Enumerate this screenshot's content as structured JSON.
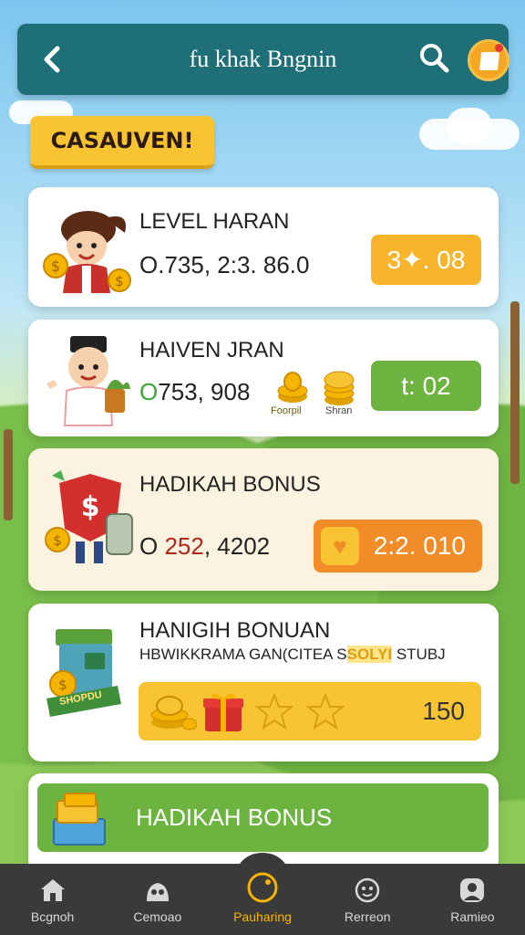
{
  "header": {
    "title": "fu khak Bngnin",
    "back_icon": "back-arrow-icon",
    "search_icon": "search-icon",
    "profile_icon": "notification-avatar-icon"
  },
  "tag": {
    "label": "CASAUVEN!"
  },
  "cards": [
    {
      "title": "LEVEL HARAN",
      "value": "O.735, 2:3. 86.0",
      "badge": "3✦. 08",
      "badge_color": "#f8b52c"
    },
    {
      "title": "HAIVEN JRAN",
      "value_prefix": "O",
      "value": "753, 908",
      "coin_label_1": "Foorpil",
      "coin_label_2": "Shran",
      "badge": "t: 02",
      "badge_color": "#6cb33f"
    },
    {
      "title": "HADIKAH BONUS",
      "value_prefix": "O",
      "value": "252",
      "value_rest": ", 4202",
      "badge": "2:2. 010",
      "badge_color": "#f28c28"
    },
    {
      "title": "HANIGIH BONUAN",
      "subtitle_start": "HBWIKKRAMA GAN(CITEA S",
      "subtitle_highlight": "SOLYI",
      "subtitle_end": " STUBJ",
      "box_label": "SHOPDU",
      "reward_value": "150"
    },
    {
      "title": "HADIKAH BONUS"
    }
  ],
  "nav": {
    "items": [
      {
        "label": "Bcgnoh",
        "icon": "home-icon"
      },
      {
        "label": "Cemoao",
        "icon": "community-icon"
      },
      {
        "label": "Pauharing",
        "icon": "center-circle-icon",
        "active": true
      },
      {
        "label": "Rerreon",
        "icon": "face-icon"
      },
      {
        "label": "Ramieo",
        "icon": "profile-icon"
      }
    ]
  }
}
